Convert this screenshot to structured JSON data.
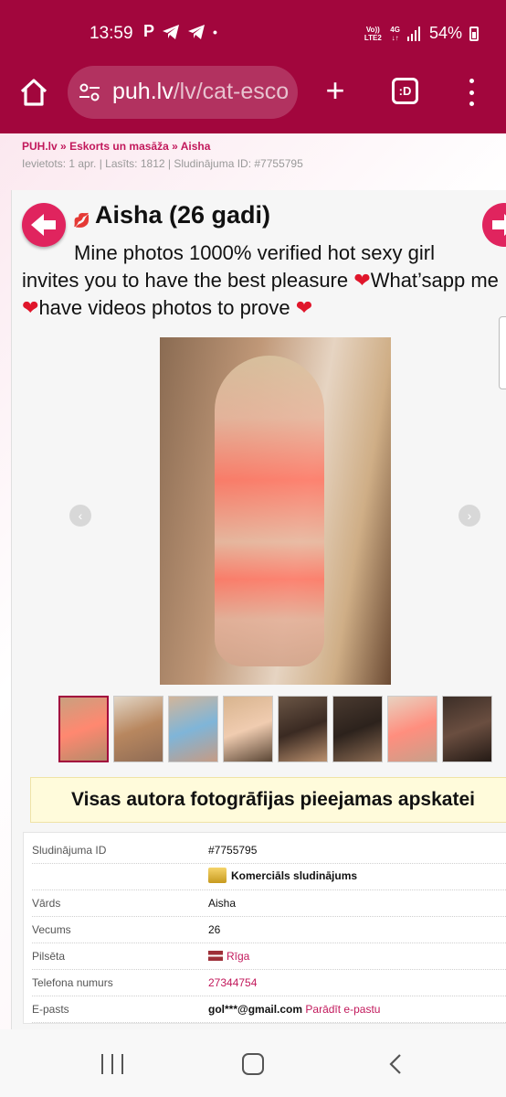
{
  "status_bar": {
    "time": "13:59",
    "app_icons": [
      "P",
      "telegram-icon",
      "telegram-icon",
      "•"
    ],
    "network_top": "Vo)) LTE2",
    "network_gen": "4G",
    "battery": "54%"
  },
  "browser": {
    "url_host": "puh.lv",
    "url_path": "/lv/cat-esco",
    "tabs_label": ":D"
  },
  "breadcrumb": {
    "site": "PUH.lv",
    "separator": "»",
    "category": "Eskorts un masāža",
    "current": "Aisha"
  },
  "meta_line": "Ievietots: 1 apr. | Lasīts: 1812 | Sludinājuma ID: #7755795",
  "listing": {
    "title": "Aisha (26 gadi)",
    "desc_line1": "Mine photos 1000% verified hot sexy girl",
    "desc_line2": "invites you to have the best pleasure",
    "desc_line2b": "What’sapp me",
    "desc_line3": "have videos photos to prove",
    "heart": "❤"
  },
  "gallery": {
    "thumbnail_count": 8,
    "selected_index": 0
  },
  "notice": "Visas autora fotogrāfijas pieejamas apskatei",
  "details": {
    "rows": [
      {
        "label": "Sludinājuma ID",
        "value": "#7755795"
      },
      {
        "label": "",
        "value": "Komerciāls sludinājums"
      },
      {
        "label": "Vārds",
        "value": "Aisha"
      },
      {
        "label": "Vecums",
        "value": "26"
      },
      {
        "label": "Pilsēta",
        "value": "Rīga"
      },
      {
        "label": "Telefona numurs",
        "value": "27344754"
      },
      {
        "label": "E-pasts",
        "value": "gol***@gmail.com",
        "action": "Parādīt e-pastu"
      }
    ]
  },
  "colors": {
    "brand": "#a2063d",
    "accent": "#c2185b",
    "button": "#e0245e"
  }
}
